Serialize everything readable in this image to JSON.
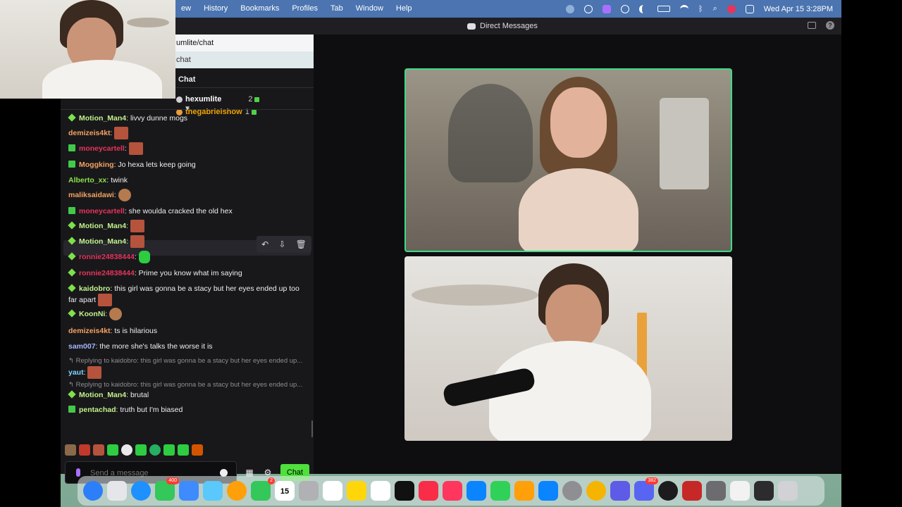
{
  "menubar": {
    "items": [
      "ew",
      "History",
      "Bookmarks",
      "Profiles",
      "Tab",
      "Window",
      "Help"
    ],
    "datetime": "Wed Apr 15  3:28PM"
  },
  "window": {
    "title": "Direct Messages",
    "url_fragment": "umlite/chat",
    "chat_link": "chat"
  },
  "chat": {
    "header": "Chat",
    "leaderboard": [
      {
        "name": "hexumlite",
        "count": "2",
        "color": "#ffffff"
      },
      {
        "name": "thegabrielshow",
        "count": "1",
        "color": "#f0a500"
      }
    ],
    "messages": [
      {
        "badge": "diamond",
        "user": "Motion_Man4",
        "color": "#c3f28b",
        "text": "livvy dunne mogs",
        "emote": ""
      },
      {
        "badge": "",
        "user": "demizeis4kt",
        "color": "#f4a261",
        "text": "",
        "emote": "box"
      },
      {
        "badge": "gift",
        "user": "moneycartell",
        "color": "#e8345b",
        "text": "",
        "emote": "box"
      },
      {
        "badge": "gift",
        "user": "Moggking",
        "color": "#f4a261",
        "text": "Jo hexa lets keep going",
        "emote": ""
      },
      {
        "badge": "",
        "user": "Alberto_xx",
        "color": "#8be04b",
        "text": "twink",
        "emote": ""
      },
      {
        "badge": "",
        "user": "maliksaidawi",
        "color": "#f4a261",
        "text": "",
        "emote": "face"
      },
      {
        "badge": "gift",
        "user": "moneycartell",
        "color": "#e8345b",
        "text": "she woulda cracked the old hex",
        "emote": ""
      },
      {
        "badge": "diamond",
        "user": "Motion_Man4",
        "color": "#c3f28b",
        "text": "",
        "emote": "box"
      },
      {
        "badge": "diamond",
        "user": "Motion_Man4",
        "color": "#c3f28b",
        "text": "",
        "emote": "box"
      },
      {
        "badge": "diamond",
        "user": "ronnie24838444",
        "color": "#e8345b",
        "text": "",
        "emote": "frog"
      },
      {
        "badge": "diamond",
        "user": "ronnie24838444",
        "color": "#e8345b",
        "text": "Prime you know what im saying",
        "emote": ""
      },
      {
        "badge": "diamond",
        "user": "kaidobro",
        "color": "#c3f28b",
        "text": "this girl was gonna be a stacy but her eyes ended up too far apart",
        "emote": "box"
      },
      {
        "badge": "diamond",
        "user": "KoonNi",
        "color": "#c3f28b",
        "text": "",
        "emote": "face"
      },
      {
        "badge": "",
        "user": "demizeis4kt",
        "color": "#f4a261",
        "text": "ts is hilarious",
        "emote": ""
      },
      {
        "badge": "",
        "user": "sam007",
        "color": "#a5b4fc",
        "text": "the more she's talks the worse it is",
        "emote": ""
      },
      {
        "badge": "",
        "user": "yaut",
        "color": "#7dd3fc",
        "text": "",
        "emote": "box",
        "reply": "Replying to kaidobro: this girl was gonna be a stacy but her eyes ended up..."
      },
      {
        "badge": "diamond",
        "user": "Motion_Man4",
        "color": "#c3f28b",
        "text": "brutal",
        "emote": "",
        "reply": "Replying to kaidobro: this girl was gonna be a stacy but her eyes ended up..."
      },
      {
        "badge": "gift",
        "user": "pentachad",
        "color": "#c3f28b",
        "text": "truth but I'm biased",
        "emote": ""
      }
    ],
    "composer_placeholder": "Send a message",
    "send_label": "Chat"
  },
  "dock": {
    "badges": {
      "messages_count": "400",
      "facetime_count": "2",
      "discord_count": "382"
    },
    "calendar_day": "15"
  },
  "colors": {
    "accent_green": "#4fe03c",
    "frame_green": "#3ddc84",
    "chat_bg": "#18181b"
  }
}
